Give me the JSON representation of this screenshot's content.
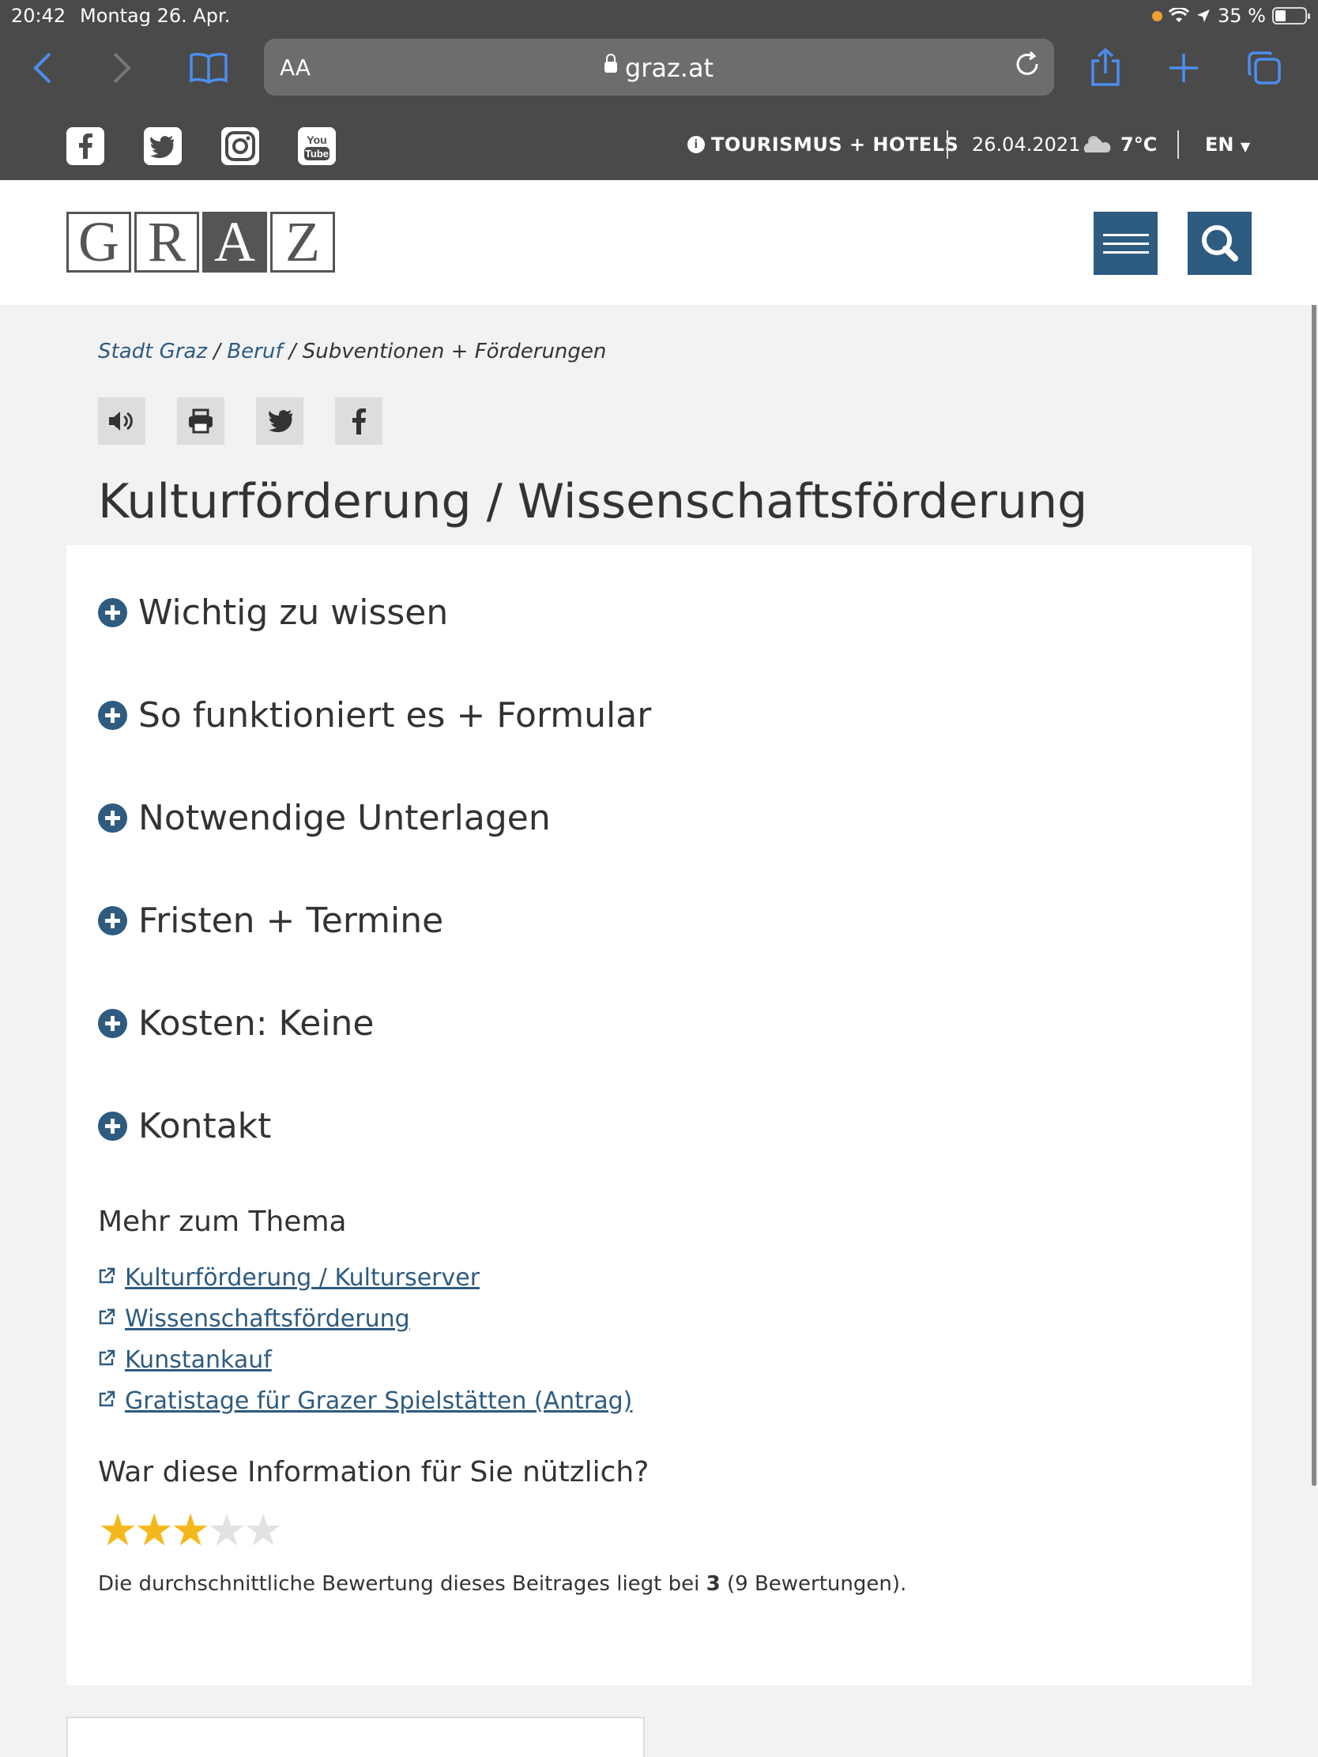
{
  "status_bar": {
    "time": "20:42",
    "date": "Montag 26. Apr.",
    "battery": "35 %"
  },
  "browser": {
    "aa_label": "AA",
    "url": "graz.at"
  },
  "topbar": {
    "social": [
      {
        "name": "facebook",
        "glyph": "f"
      },
      {
        "name": "twitter",
        "glyph": "t"
      },
      {
        "name": "instagram",
        "glyph": "◎"
      },
      {
        "name": "youtube",
        "glyph": "You Tube"
      }
    ],
    "tourism_label": "TOURISMUS + HOTELS",
    "date": "26.04.2021",
    "temperature": "7°C",
    "language": "EN"
  },
  "header": {
    "logo_letters": [
      "G",
      "R",
      "A",
      "Z"
    ]
  },
  "breadcrumb": {
    "items": [
      {
        "label": "Stadt Graz"
      },
      {
        "label": "Beruf"
      },
      {
        "label": "Subventionen + Förderungen"
      }
    ]
  },
  "title": "Kulturförderung / Wissenschaftsförderung",
  "accordion": [
    {
      "label": "Wichtig zu wissen"
    },
    {
      "label": "So funktioniert es + Formular"
    },
    {
      "label": "Notwendige Unterlagen"
    },
    {
      "label": "Fristen + Termine"
    },
    {
      "label": "Kosten: Keine"
    },
    {
      "label": "Kontakt"
    }
  ],
  "related": {
    "title": "Mehr zum Thema",
    "links": [
      {
        "label": "Kulturförderung / Kulturserver"
      },
      {
        "label": "Wissenschaftsförderung"
      },
      {
        "label": "Kunstankauf"
      },
      {
        "label": "Gratistage für Grazer Spielstätten (Antrag)"
      }
    ]
  },
  "rating": {
    "question": "War diese Information für Sie nützlich?",
    "stars_filled": 3,
    "stars_total": 5,
    "text_before": "Die durchschnittliche Bewertung dieses Beitrages liegt bei ",
    "average": "3",
    "text_after": " (9 Bewertungen)."
  },
  "colors": {
    "brand_blue": "#2e5b80",
    "star": "#f5b81c",
    "dark_bar": "#4a4a4a"
  }
}
